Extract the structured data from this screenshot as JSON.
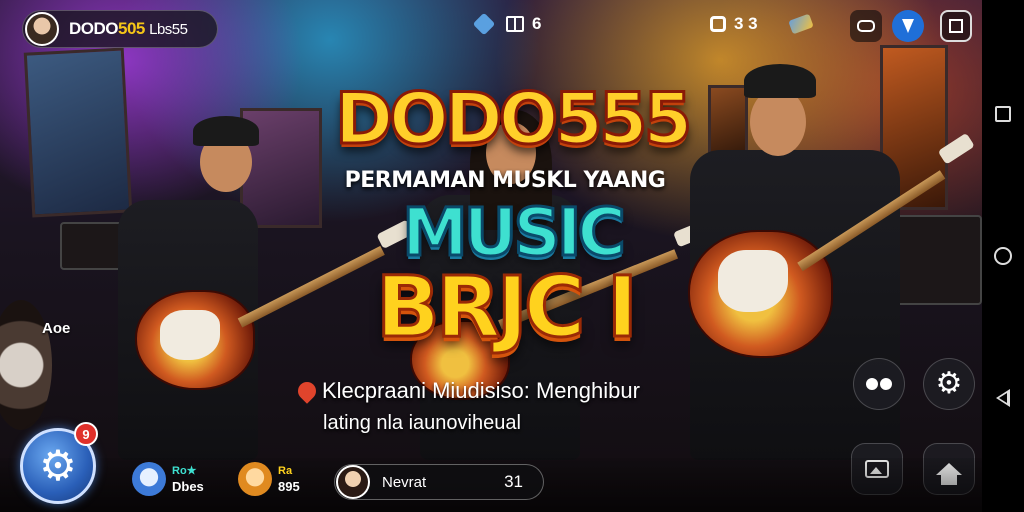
{
  "header": {
    "profile_name_prefix": "DODO",
    "profile_name_highlight": "505",
    "profile_name_suffix": "Lbs55",
    "stat_a_value": "6",
    "stat_b_value": "3 3"
  },
  "hero": {
    "title": "DODO555",
    "subtitle": "PERMAMAN MUSKL YAANG",
    "music_word": "MUSIC",
    "brand_word": "BRJC I",
    "tagline": "Klecpraani Miudisiso: Menghibur",
    "tagline_sub": "lating nla iaunoviheual",
    "side_label": "Aoe"
  },
  "bottom": {
    "settings_badge": "9",
    "friends": [
      {
        "top": "Ro★",
        "bottom": "Dbes",
        "color": "#3ee0d0"
      },
      {
        "top": "Ra",
        "bottom": "895",
        "color": "#ffd21e"
      }
    ],
    "chat": {
      "name": "Nevrat",
      "count": "31"
    }
  },
  "icons": {
    "top_left": "avatar",
    "top_stats": [
      "diamond-icon",
      "gift-icon",
      "ring-icon",
      "ticket-icon"
    ],
    "top_right": [
      "gamepad-icon",
      "lightning-icon",
      "frame-icon"
    ],
    "right_side": [
      "glasses-icon",
      "gear-icon",
      "picture-icon",
      "home-icon"
    ],
    "nav": [
      "recents-icon",
      "home-circle-icon",
      "back-icon"
    ]
  },
  "colors": {
    "title_gold": "#ffcf2a",
    "music_teal": "#3ee0d0",
    "badge_red": "#e0302a",
    "fab_blue": "#2a5fb8"
  }
}
